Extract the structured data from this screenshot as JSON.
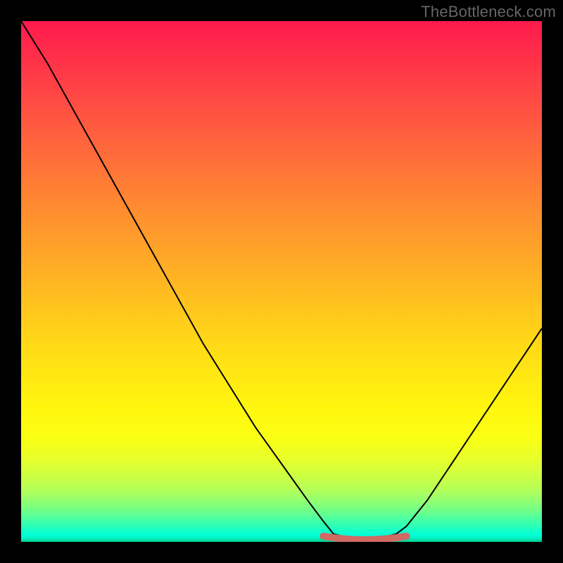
{
  "watermark": "TheBottleneck.com",
  "chart_data": {
    "type": "line",
    "title": "",
    "xlabel": "",
    "ylabel": "",
    "xlim": [
      0,
      100
    ],
    "ylim": [
      0,
      100
    ],
    "curve": {
      "description": "Bottleneck/mismatch curve descending from top-left, flattening near bottom around x≈60-72, rising again to the right",
      "x": [
        0,
        5,
        10,
        15,
        20,
        25,
        30,
        35,
        40,
        45,
        50,
        55,
        58,
        60,
        64,
        68,
        72,
        74,
        78,
        82,
        86,
        90,
        94,
        98,
        100
      ],
      "y": [
        100,
        92,
        83,
        74,
        65,
        56,
        47,
        38,
        30,
        22,
        15,
        8,
        4,
        1.5,
        0.5,
        0.5,
        1.5,
        3,
        8,
        14,
        20,
        26,
        32,
        38,
        41
      ]
    },
    "highlight": {
      "description": "Flat minimum segment marked in salmon",
      "x_start": 58,
      "x_end": 74,
      "y": 0.5,
      "color": "#d06a62"
    },
    "background_gradient": {
      "top": "#ff1a4d",
      "mid": "#ffe812",
      "bottom": "#00d090"
    }
  }
}
